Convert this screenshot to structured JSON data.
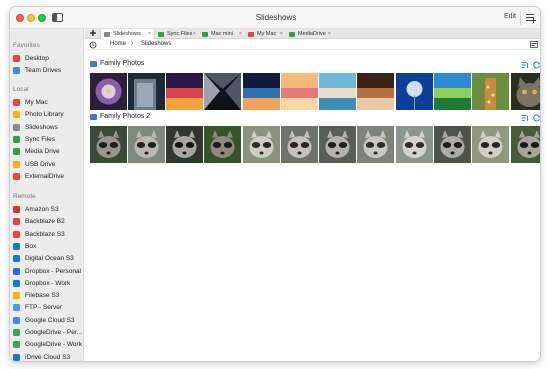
{
  "window": {
    "title": "Slideshows",
    "edit_label": "Edit"
  },
  "sidebar": {
    "sections": [
      {
        "label": "Favorites",
        "items": [
          {
            "label": "Desktop",
            "icon": "folder-red-icon",
            "color": "#e8453c"
          },
          {
            "label": "Team Drives",
            "icon": "google-drive-icon",
            "color": "#4285f4"
          }
        ]
      },
      {
        "label": "Local",
        "items": [
          {
            "label": "My Mac",
            "icon": "home-icon",
            "color": "#e8453c"
          },
          {
            "label": "Photo Library",
            "icon": "photos-icon",
            "color": "#f4b400"
          },
          {
            "label": "Slideshows",
            "icon": "slideshow-icon",
            "color": "#8a8a8a"
          },
          {
            "label": "Sync Files",
            "icon": "sync-icon",
            "color": "#2e9e4f"
          },
          {
            "label": "Media Drive",
            "icon": "drive-icon",
            "color": "#2e9e4f"
          },
          {
            "label": "USB Drive",
            "icon": "usb-icon",
            "color": "#f4b400"
          },
          {
            "label": "ExternalDrive",
            "icon": "folder-red-icon",
            "color": "#e8453c"
          }
        ]
      },
      {
        "label": "Remote",
        "items": [
          {
            "label": "Amazon S3",
            "icon": "amazon-s3-icon",
            "color": "#c7392b"
          },
          {
            "label": "Backblaze B2",
            "icon": "backblaze-icon",
            "color": "#e8453c"
          },
          {
            "label": "Backblaze S3",
            "icon": "backblaze-icon",
            "color": "#e8453c"
          },
          {
            "label": "Box",
            "icon": "box-icon",
            "color": "#1a73e8"
          },
          {
            "label": "Digital Ocean S3",
            "icon": "digital-ocean-icon",
            "color": "#1a73e8"
          },
          {
            "label": "Dropbox - Personal",
            "icon": "dropbox-icon",
            "color": "#1a73e8"
          },
          {
            "label": "Dropbox - Work",
            "icon": "dropbox-icon",
            "color": "#1a73e8"
          },
          {
            "label": "Filebase S3",
            "icon": "filebase-icon",
            "color": "#f4b400"
          },
          {
            "label": "FTP - Server",
            "icon": "ftp-icon",
            "color": "#4a9bd8"
          },
          {
            "label": "Google Cloud S3",
            "icon": "google-cloud-icon",
            "color": "#4285f4"
          },
          {
            "label": "GoogleDrive - Per...",
            "icon": "google-drive-icon",
            "color": "#34a853"
          },
          {
            "label": "GoogleDrive - Work",
            "icon": "google-drive-icon",
            "color": "#34a853"
          },
          {
            "label": "iDrive Cloud S3",
            "icon": "idrive-icon",
            "color": "#1a73e8"
          }
        ]
      }
    ]
  },
  "tabs": [
    {
      "label": "Slideshows",
      "icon": "slideshow-icon",
      "color": "#8a8a8a",
      "active": true
    },
    {
      "label": "Sync Files",
      "icon": "sync-icon",
      "color": "#2e9e4f",
      "active": false
    },
    {
      "label": "Mac mini",
      "icon": "computer-icon",
      "color": "#2e9e4f",
      "active": false
    },
    {
      "label": "My Mac",
      "icon": "home-icon",
      "color": "#e8453c",
      "active": false
    },
    {
      "label": "MediaDrive",
      "icon": "drive-icon",
      "color": "#2e9e4f",
      "active": false
    }
  ],
  "breadcrumb": {
    "items": [
      "Home",
      "Slideshows"
    ]
  },
  "groups": [
    {
      "title": "Family Photos",
      "photos": [
        {
          "name": "flower-photo",
          "colors": [
            "#2a1f3d",
            "#d9d2e8",
            "#8b5ea8"
          ]
        },
        {
          "name": "building-photo",
          "colors": [
            "#1e2a35",
            "#6a7e8e",
            "#c9d3da"
          ]
        },
        {
          "name": "sunset-sky-photo",
          "colors": [
            "#2b1748",
            "#d8444c",
            "#f6a23a"
          ]
        },
        {
          "name": "skyscrapers-photo",
          "colors": [
            "#0d1016",
            "#9aa3ad",
            "#4f5763"
          ]
        },
        {
          "name": "twilight-photo",
          "colors": [
            "#101c3a",
            "#2f6fb0",
            "#f0a25a"
          ]
        },
        {
          "name": "pink-sunset-photo",
          "colors": [
            "#f2b97a",
            "#e7787c",
            "#ffd8a6"
          ]
        },
        {
          "name": "beach-photo",
          "colors": [
            "#6fb7d6",
            "#e9dfc8",
            "#3b8fb2"
          ]
        },
        {
          "name": "wooden-hut-photo",
          "colors": [
            "#3a2418",
            "#b4703e",
            "#e7c8a2"
          ]
        },
        {
          "name": "dandelion-photo",
          "colors": [
            "#0c3f9a",
            "#3a8fe0",
            "#e6f1ff"
          ]
        },
        {
          "name": "green-field-photo",
          "colors": [
            "#2d8bd6",
            "#8ad05a",
            "#1f7a34"
          ]
        },
        {
          "name": "giraffe-photo",
          "colors": [
            "#6a8e3e",
            "#c98b3d",
            "#f0e3b8"
          ]
        },
        {
          "name": "cat-photo",
          "colors": [
            "#2a2f22",
            "#7a7363",
            "#c3b9a2"
          ]
        }
      ]
    },
    {
      "title": "Family Photos 2",
      "photos": [
        {
          "name": "raccoon-photo",
          "colors": [
            "#3b4a34",
            "#9a958a",
            "#1d1f1d"
          ]
        },
        {
          "name": "raccoon-photo",
          "colors": [
            "#7f8a7a",
            "#bcb8ad",
            "#232421"
          ]
        },
        {
          "name": "raccoon-photo",
          "colors": [
            "#2f382c",
            "#a9a69d",
            "#141513"
          ]
        },
        {
          "name": "raccoon-photo",
          "colors": [
            "#35542c",
            "#8f8a79",
            "#1b1c18"
          ]
        },
        {
          "name": "raccoon-photo",
          "colors": [
            "#8a9280",
            "#d0cdc4",
            "#2a2b28"
          ]
        },
        {
          "name": "raccoon-photo",
          "colors": [
            "#6e7367",
            "#c6c2b8",
            "#262723"
          ]
        },
        {
          "name": "raccoon-photo",
          "colors": [
            "#595f55",
            "#b5b2a9",
            "#20211e"
          ]
        },
        {
          "name": "raccoon-photo",
          "colors": [
            "#7d8578",
            "#cac7bf",
            "#2c2d29"
          ]
        },
        {
          "name": "raccoon-photo",
          "colors": [
            "#8d968a",
            "#d6d3cb",
            "#2e2f2b"
          ]
        },
        {
          "name": "raccoon-photo",
          "colors": [
            "#4c5547",
            "#aeaba2",
            "#1c1d1a"
          ]
        },
        {
          "name": "raccoon-photo",
          "colors": [
            "#8f977f",
            "#d2cfc5",
            "#272824"
          ]
        },
        {
          "name": "raccoon-photo",
          "colors": [
            "#495a3a",
            "#a7a396",
            "#1a1b17"
          ]
        }
      ]
    }
  ]
}
